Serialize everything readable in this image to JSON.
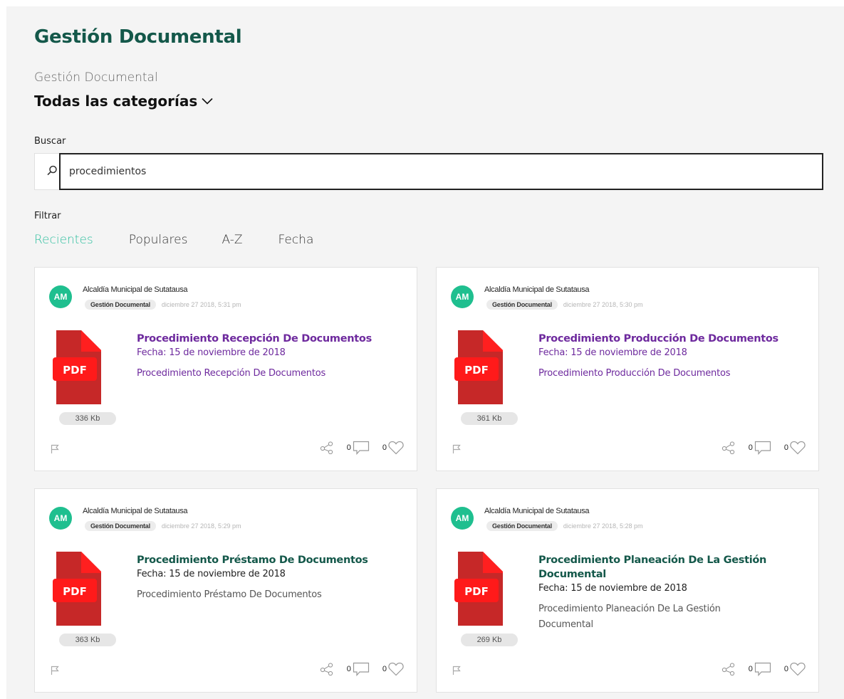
{
  "header": {
    "title": "Gestión Documental",
    "subtitle": "Gestión Documental",
    "category_selector": "Todas las categorías"
  },
  "search": {
    "label": "Buscar",
    "value": "procedimientos"
  },
  "filters": {
    "label": "Filtrar",
    "options": [
      "Recientes",
      "Populares",
      "A-Z",
      "Fecha"
    ],
    "active": "Recientes"
  },
  "icons": {
    "search": "search-icon",
    "dropdown": "chevron-down-icon",
    "document": "pdf-file-icon",
    "flag": "flag-icon",
    "share": "share-icon",
    "comments": "comment-icon",
    "likes": "heart-icon"
  },
  "colors": {
    "brand": "#14584a",
    "accent": "#2fbf9f",
    "avatar": "#1fbf8f",
    "visited_link": "#6e2a9e",
    "pdf_red": "#c62828"
  },
  "cards": [
    {
      "avatar_initials": "AM",
      "author": "Alcaldía Municipal de Sutatausa",
      "category": "Gestión Documental",
      "posted": "diciembre 27 2018, 5:31 pm",
      "file_type": "PDF",
      "title": "Procedimiento Recepción De Documentos",
      "date": "Fecha: 15 de noviembre de 2018",
      "description": "Procedimiento Recepción De Documentos",
      "size": "336 Kb",
      "comments": "0",
      "likes": "0"
    },
    {
      "avatar_initials": "AM",
      "author": "Alcaldía Municipal de Sutatausa",
      "category": "Gestión Documental",
      "posted": "diciembre 27 2018, 5:30 pm",
      "file_type": "PDF",
      "title": "Procedimiento Producción De Documentos",
      "date": "Fecha: 15 de noviembre de 2018",
      "description": "Procedimiento Producción De Documentos",
      "size": "361 Kb",
      "comments": "0",
      "likes": "0"
    },
    {
      "avatar_initials": "AM",
      "author": "Alcaldía Municipal de Sutatausa",
      "category": "Gestión Documental",
      "posted": "diciembre 27 2018, 5:29 pm",
      "file_type": "PDF",
      "title": "Procedimiento Préstamo De Documentos",
      "date": "Fecha: 15 de noviembre de 2018",
      "description": "Procedimiento Préstamo De Documentos",
      "size": "363 Kb",
      "comments": "0",
      "likes": "0"
    },
    {
      "avatar_initials": "AM",
      "author": "Alcaldía Municipal de Sutatausa",
      "category": "Gestión Documental",
      "posted": "diciembre 27 2018, 5:28 pm",
      "file_type": "PDF",
      "title": "Procedimiento Planeación De La Gestión Documental",
      "date": "Fecha: 15 de noviembre de 2018",
      "description": "Procedimiento Planeación De La Gestión Documental",
      "size": "269 Kb",
      "comments": "0",
      "likes": "0"
    }
  ]
}
